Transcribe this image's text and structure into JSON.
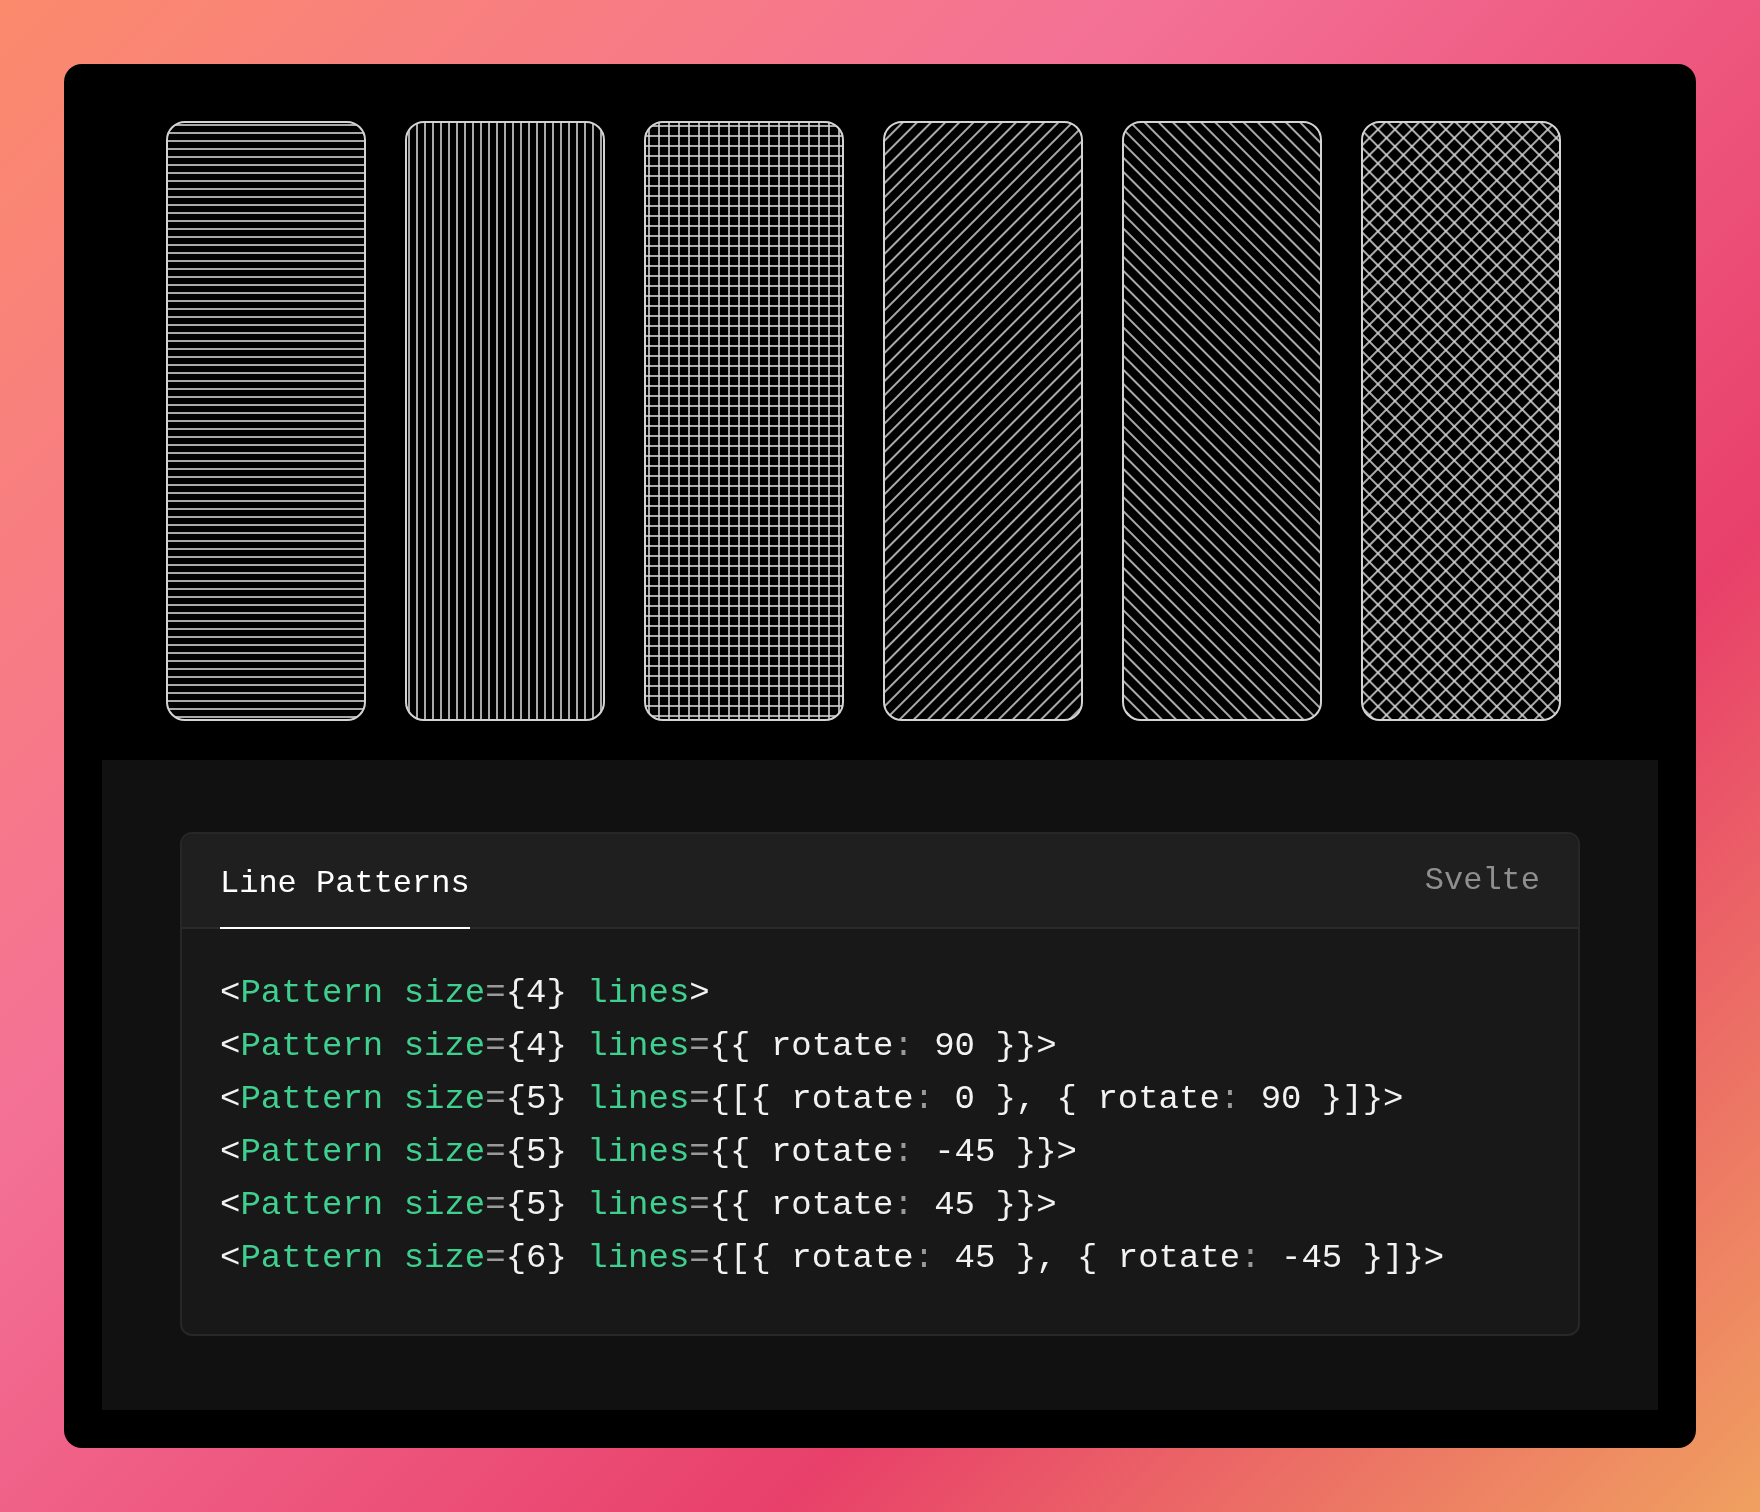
{
  "patterns": [
    {
      "kind": "horizontal"
    },
    {
      "kind": "vertical"
    },
    {
      "kind": "grid"
    },
    {
      "kind": "diagonal-up"
    },
    {
      "kind": "diagonal-down"
    },
    {
      "kind": "crosshatch"
    }
  ],
  "code_panel": {
    "tabs": [
      {
        "label": "Line Patterns",
        "selected": true
      }
    ],
    "language": "Svelte",
    "lines": [
      [
        {
          "kind": "punct",
          "text": "<"
        },
        {
          "kind": "name",
          "text": "Pattern size"
        },
        {
          "kind": "op",
          "text": "="
        },
        {
          "kind": "punct",
          "text": "{4} "
        },
        {
          "kind": "name",
          "text": "lines"
        },
        {
          "kind": "punct",
          "text": ">"
        }
      ],
      [
        {
          "kind": "punct",
          "text": "<"
        },
        {
          "kind": "name",
          "text": "Pattern size"
        },
        {
          "kind": "op",
          "text": "="
        },
        {
          "kind": "punct",
          "text": "{4} "
        },
        {
          "kind": "name",
          "text": "lines"
        },
        {
          "kind": "op",
          "text": "="
        },
        {
          "kind": "punct",
          "text": "{{ rotate"
        },
        {
          "kind": "op",
          "text": ":"
        },
        {
          "kind": "punct",
          "text": " 90 }}>"
        }
      ],
      [
        {
          "kind": "punct",
          "text": "<"
        },
        {
          "kind": "name",
          "text": "Pattern size"
        },
        {
          "kind": "op",
          "text": "="
        },
        {
          "kind": "punct",
          "text": "{5} "
        },
        {
          "kind": "name",
          "text": "lines"
        },
        {
          "kind": "op",
          "text": "="
        },
        {
          "kind": "punct",
          "text": "{[{ rotate"
        },
        {
          "kind": "op",
          "text": ":"
        },
        {
          "kind": "punct",
          "text": " 0 }, { rotate"
        },
        {
          "kind": "op",
          "text": ":"
        },
        {
          "kind": "punct",
          "text": " 90 }]}>"
        }
      ],
      [
        {
          "kind": "punct",
          "text": "<"
        },
        {
          "kind": "name",
          "text": "Pattern size"
        },
        {
          "kind": "op",
          "text": "="
        },
        {
          "kind": "punct",
          "text": "{5} "
        },
        {
          "kind": "name",
          "text": "lines"
        },
        {
          "kind": "op",
          "text": "="
        },
        {
          "kind": "punct",
          "text": "{{ rotate"
        },
        {
          "kind": "op",
          "text": ":"
        },
        {
          "kind": "punct",
          "text": " -45 }}>"
        }
      ],
      [
        {
          "kind": "punct",
          "text": "<"
        },
        {
          "kind": "name",
          "text": "Pattern size"
        },
        {
          "kind": "op",
          "text": "="
        },
        {
          "kind": "punct",
          "text": "{5} "
        },
        {
          "kind": "name",
          "text": "lines"
        },
        {
          "kind": "op",
          "text": "="
        },
        {
          "kind": "punct",
          "text": "{{ rotate"
        },
        {
          "kind": "op",
          "text": ":"
        },
        {
          "kind": "punct",
          "text": " 45 }}>"
        }
      ],
      [
        {
          "kind": "punct",
          "text": "<"
        },
        {
          "kind": "name",
          "text": "Pattern size"
        },
        {
          "kind": "op",
          "text": "="
        },
        {
          "kind": "punct",
          "text": "{6} "
        },
        {
          "kind": "name",
          "text": "lines"
        },
        {
          "kind": "op",
          "text": "="
        },
        {
          "kind": "punct",
          "text": "{[{ rotate"
        },
        {
          "kind": "op",
          "text": ":"
        },
        {
          "kind": "punct",
          "text": " 45 }, { rotate"
        },
        {
          "kind": "op",
          "text": ":"
        },
        {
          "kind": "punct",
          "text": " -45 }]}>"
        }
      ]
    ]
  }
}
